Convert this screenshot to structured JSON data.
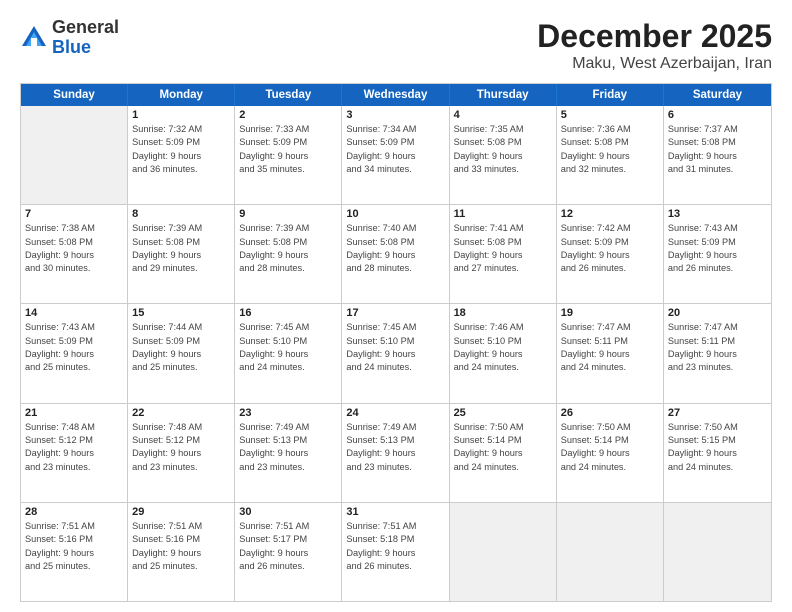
{
  "header": {
    "logo_general": "General",
    "logo_blue": "Blue",
    "month": "December 2025",
    "location": "Maku, West Azerbaijan, Iran"
  },
  "weekdays": [
    "Sunday",
    "Monday",
    "Tuesday",
    "Wednesday",
    "Thursday",
    "Friday",
    "Saturday"
  ],
  "rows": [
    [
      {
        "day": "",
        "lines": [],
        "shaded": true
      },
      {
        "day": "1",
        "lines": [
          "Sunrise: 7:32 AM",
          "Sunset: 5:09 PM",
          "Daylight: 9 hours",
          "and 36 minutes."
        ]
      },
      {
        "day": "2",
        "lines": [
          "Sunrise: 7:33 AM",
          "Sunset: 5:09 PM",
          "Daylight: 9 hours",
          "and 35 minutes."
        ]
      },
      {
        "day": "3",
        "lines": [
          "Sunrise: 7:34 AM",
          "Sunset: 5:09 PM",
          "Daylight: 9 hours",
          "and 34 minutes."
        ]
      },
      {
        "day": "4",
        "lines": [
          "Sunrise: 7:35 AM",
          "Sunset: 5:08 PM",
          "Daylight: 9 hours",
          "and 33 minutes."
        ]
      },
      {
        "day": "5",
        "lines": [
          "Sunrise: 7:36 AM",
          "Sunset: 5:08 PM",
          "Daylight: 9 hours",
          "and 32 minutes."
        ]
      },
      {
        "day": "6",
        "lines": [
          "Sunrise: 7:37 AM",
          "Sunset: 5:08 PM",
          "Daylight: 9 hours",
          "and 31 minutes."
        ]
      }
    ],
    [
      {
        "day": "7",
        "lines": [
          "Sunrise: 7:38 AM",
          "Sunset: 5:08 PM",
          "Daylight: 9 hours",
          "and 30 minutes."
        ]
      },
      {
        "day": "8",
        "lines": [
          "Sunrise: 7:39 AM",
          "Sunset: 5:08 PM",
          "Daylight: 9 hours",
          "and 29 minutes."
        ]
      },
      {
        "day": "9",
        "lines": [
          "Sunrise: 7:39 AM",
          "Sunset: 5:08 PM",
          "Daylight: 9 hours",
          "and 28 minutes."
        ]
      },
      {
        "day": "10",
        "lines": [
          "Sunrise: 7:40 AM",
          "Sunset: 5:08 PM",
          "Daylight: 9 hours",
          "and 28 minutes."
        ]
      },
      {
        "day": "11",
        "lines": [
          "Sunrise: 7:41 AM",
          "Sunset: 5:08 PM",
          "Daylight: 9 hours",
          "and 27 minutes."
        ]
      },
      {
        "day": "12",
        "lines": [
          "Sunrise: 7:42 AM",
          "Sunset: 5:09 PM",
          "Daylight: 9 hours",
          "and 26 minutes."
        ]
      },
      {
        "day": "13",
        "lines": [
          "Sunrise: 7:43 AM",
          "Sunset: 5:09 PM",
          "Daylight: 9 hours",
          "and 26 minutes."
        ]
      }
    ],
    [
      {
        "day": "14",
        "lines": [
          "Sunrise: 7:43 AM",
          "Sunset: 5:09 PM",
          "Daylight: 9 hours",
          "and 25 minutes."
        ]
      },
      {
        "day": "15",
        "lines": [
          "Sunrise: 7:44 AM",
          "Sunset: 5:09 PM",
          "Daylight: 9 hours",
          "and 25 minutes."
        ]
      },
      {
        "day": "16",
        "lines": [
          "Sunrise: 7:45 AM",
          "Sunset: 5:10 PM",
          "Daylight: 9 hours",
          "and 24 minutes."
        ]
      },
      {
        "day": "17",
        "lines": [
          "Sunrise: 7:45 AM",
          "Sunset: 5:10 PM",
          "Daylight: 9 hours",
          "and 24 minutes."
        ]
      },
      {
        "day": "18",
        "lines": [
          "Sunrise: 7:46 AM",
          "Sunset: 5:10 PM",
          "Daylight: 9 hours",
          "and 24 minutes."
        ]
      },
      {
        "day": "19",
        "lines": [
          "Sunrise: 7:47 AM",
          "Sunset: 5:11 PM",
          "Daylight: 9 hours",
          "and 24 minutes."
        ]
      },
      {
        "day": "20",
        "lines": [
          "Sunrise: 7:47 AM",
          "Sunset: 5:11 PM",
          "Daylight: 9 hours",
          "and 23 minutes."
        ]
      }
    ],
    [
      {
        "day": "21",
        "lines": [
          "Sunrise: 7:48 AM",
          "Sunset: 5:12 PM",
          "Daylight: 9 hours",
          "and 23 minutes."
        ]
      },
      {
        "day": "22",
        "lines": [
          "Sunrise: 7:48 AM",
          "Sunset: 5:12 PM",
          "Daylight: 9 hours",
          "and 23 minutes."
        ]
      },
      {
        "day": "23",
        "lines": [
          "Sunrise: 7:49 AM",
          "Sunset: 5:13 PM",
          "Daylight: 9 hours",
          "and 23 minutes."
        ]
      },
      {
        "day": "24",
        "lines": [
          "Sunrise: 7:49 AM",
          "Sunset: 5:13 PM",
          "Daylight: 9 hours",
          "and 23 minutes."
        ]
      },
      {
        "day": "25",
        "lines": [
          "Sunrise: 7:50 AM",
          "Sunset: 5:14 PM",
          "Daylight: 9 hours",
          "and 24 minutes."
        ]
      },
      {
        "day": "26",
        "lines": [
          "Sunrise: 7:50 AM",
          "Sunset: 5:14 PM",
          "Daylight: 9 hours",
          "and 24 minutes."
        ]
      },
      {
        "day": "27",
        "lines": [
          "Sunrise: 7:50 AM",
          "Sunset: 5:15 PM",
          "Daylight: 9 hours",
          "and 24 minutes."
        ]
      }
    ],
    [
      {
        "day": "28",
        "lines": [
          "Sunrise: 7:51 AM",
          "Sunset: 5:16 PM",
          "Daylight: 9 hours",
          "and 25 minutes."
        ]
      },
      {
        "day": "29",
        "lines": [
          "Sunrise: 7:51 AM",
          "Sunset: 5:16 PM",
          "Daylight: 9 hours",
          "and 25 minutes."
        ]
      },
      {
        "day": "30",
        "lines": [
          "Sunrise: 7:51 AM",
          "Sunset: 5:17 PM",
          "Daylight: 9 hours",
          "and 26 minutes."
        ]
      },
      {
        "day": "31",
        "lines": [
          "Sunrise: 7:51 AM",
          "Sunset: 5:18 PM",
          "Daylight: 9 hours",
          "and 26 minutes."
        ]
      },
      {
        "day": "",
        "lines": [],
        "shaded": true
      },
      {
        "day": "",
        "lines": [],
        "shaded": true
      },
      {
        "day": "",
        "lines": [],
        "shaded": true
      }
    ]
  ]
}
